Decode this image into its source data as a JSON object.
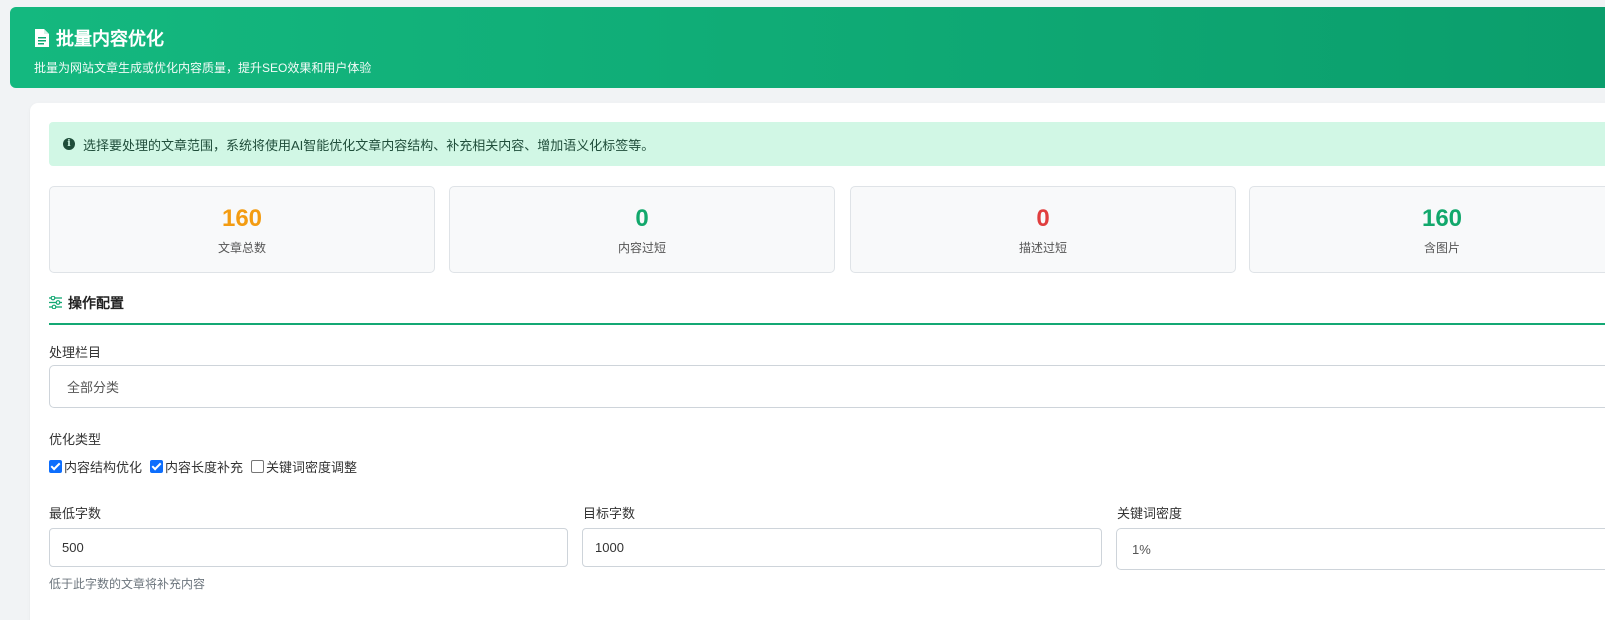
{
  "header": {
    "title": "批量内容优化",
    "subtitle": "批量为网站文章生成或优化内容质量，提升SEO效果和用户体验",
    "icon": "document-icon"
  },
  "info": {
    "text": "选择要处理的文章范围，系统将使用AI智能优化文章内容结构、补充相关内容、增加语义化标签等。",
    "icon": "info-circle-icon"
  },
  "stats": [
    {
      "value": "160",
      "label": "文章总数",
      "color": "#f39c12"
    },
    {
      "value": "0",
      "label": "内容过短",
      "color": "#12a86c"
    },
    {
      "value": "0",
      "label": "描述过短",
      "color": "#e03e3e"
    },
    {
      "value": "160",
      "label": "含图片",
      "color": "#12a86c"
    }
  ],
  "config": {
    "title": "操作配置",
    "icon": "sliders-icon",
    "category_label": "处理栏目",
    "category_value": "全部分类",
    "type_label": "优化类型",
    "types": [
      {
        "label": "内容结构优化",
        "checked": true
      },
      {
        "label": "内容长度补充",
        "checked": true
      },
      {
        "label": "关键词密度调整",
        "checked": false
      }
    ],
    "min_words_label": "最低字数",
    "min_words_value": "500",
    "min_words_hint": "低于此字数的文章将补充内容",
    "target_words_label": "目标字数",
    "target_words_value": "1000",
    "density_label": "关键词密度",
    "density_value": "1%"
  },
  "colors": {
    "accent": "#14a874",
    "info_bg": "#d1f7e5",
    "checkbox": "#0d6efd"
  }
}
